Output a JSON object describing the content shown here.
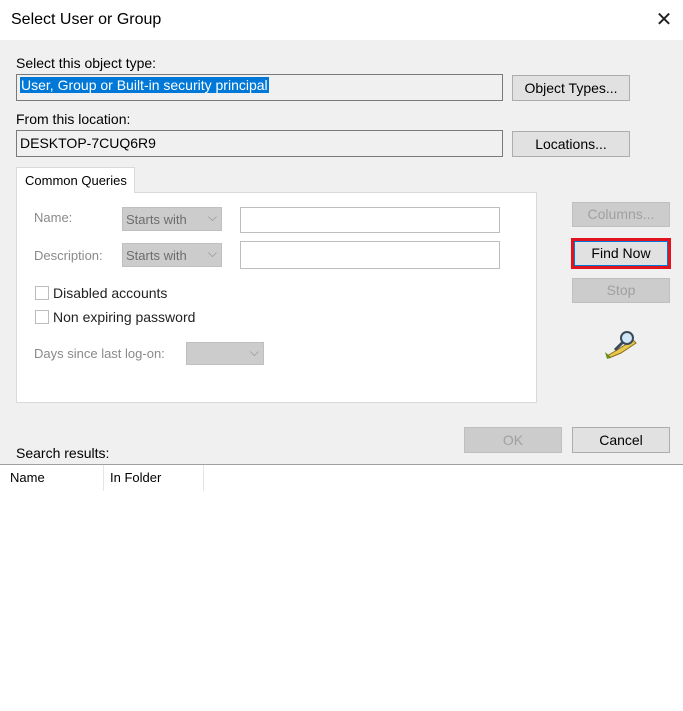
{
  "window": {
    "title": "Select User or Group",
    "close_glyph": "✕"
  },
  "object_type": {
    "label": "Select this object type:",
    "value": "User, Group or Built-in security principal",
    "button": "Object Types..."
  },
  "location": {
    "label": "From this location:",
    "value": "DESKTOP-7CUQ6R9",
    "button": "Locations..."
  },
  "tab": {
    "label": "Common Queries"
  },
  "queries": {
    "name_label": "Name:",
    "name_mode": "Starts with",
    "desc_label": "Description:",
    "desc_mode": "Starts with",
    "disabled_accounts": "Disabled accounts",
    "non_expiring": "Non expiring password",
    "days_label": "Days since last log-on:",
    "days_value": ""
  },
  "side_buttons": {
    "columns": "Columns...",
    "find_now": "Find Now",
    "stop": "Stop"
  },
  "footer": {
    "ok": "OK",
    "cancel": "Cancel"
  },
  "results": {
    "label": "Search results:",
    "columns": [
      "Name",
      "In Folder"
    ]
  },
  "colors": {
    "highlight": "#e0141e",
    "selection": "#0078d7"
  },
  "icons": {
    "search": "search-users-icon"
  }
}
